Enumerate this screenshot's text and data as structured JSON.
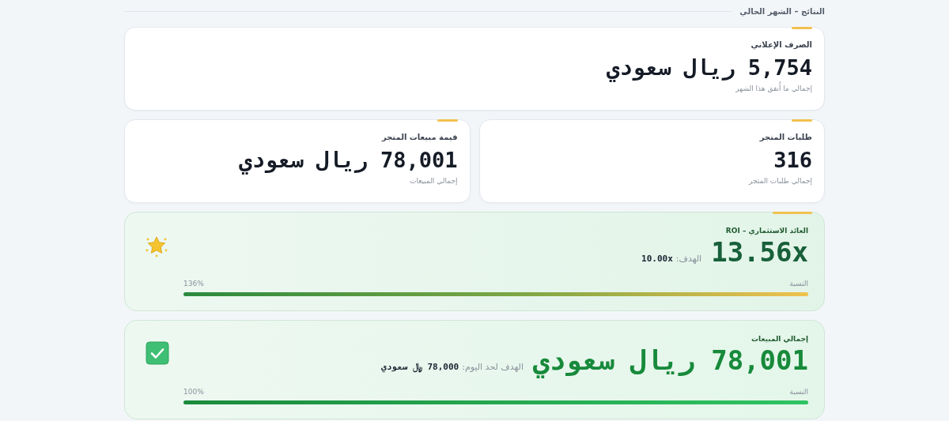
{
  "section": {
    "title": "النتائج – الشهر الحالي"
  },
  "summary": {
    "title": "الصرف الإعلاني",
    "value": "5,754 ريال سعودي",
    "subtitle": "إجمالي ما أُنفق هذا الشهر"
  },
  "stats": [
    {
      "title": "طلبات المتجر",
      "value": "316",
      "subtitle": "إجمالي طلبات المتجر"
    },
    {
      "title": "قيمة مبيعات المتجر",
      "value": "78,001 ريال سعودي",
      "subtitle": "إجمالي المبيعات"
    }
  ],
  "goals": [
    {
      "kind": "roi",
      "title": "العائد الاستثماري – ROI",
      "value": "13.56x",
      "target_label": "الهدف:",
      "target": "10.00x",
      "progress_label": "النسبة",
      "percent": "136%",
      "level": 1
    },
    {
      "kind": "sales",
      "title": "إجمالي المبيعات",
      "value": "78,001 ريال سعودي",
      "target_label": "الهدف لحد اليوم:",
      "target": "78,000 ﷼ سعودي",
      "progress_label": "النسبة",
      "percent": "100%",
      "level": 1
    }
  ]
}
